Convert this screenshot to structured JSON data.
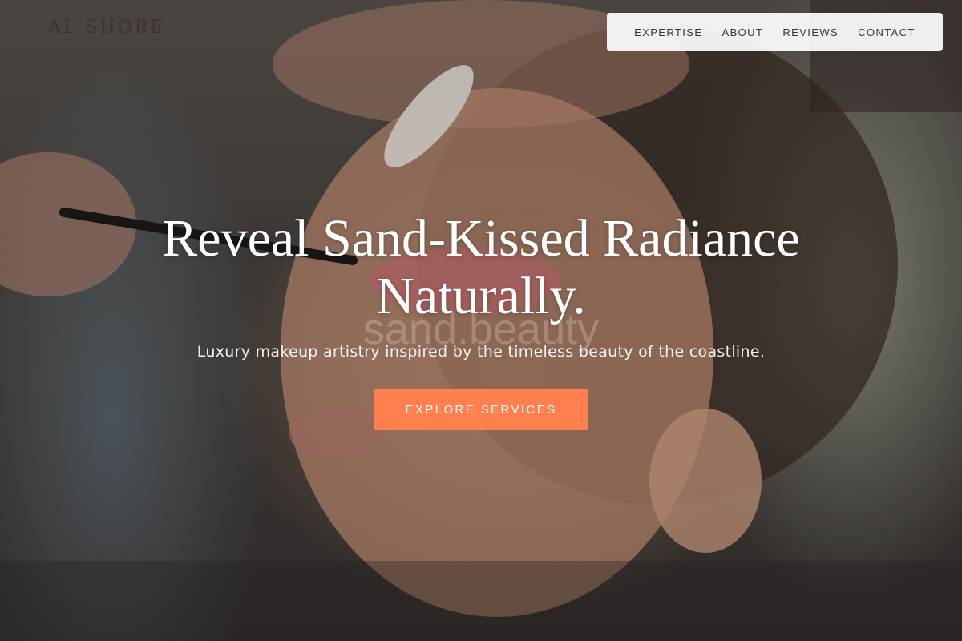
{
  "header": {
    "logo_text": "AL SHORE"
  },
  "nav": {
    "items": [
      {
        "label": "EXPERTISE"
      },
      {
        "label": "ABOUT"
      },
      {
        "label": "REVIEWS"
      },
      {
        "label": "CONTACT"
      }
    ]
  },
  "hero": {
    "headline": "Reveal Sand-Kissed Radiance Naturally.",
    "watermark": "sand.beauty",
    "subtitle": "Luxury makeup artistry inspired by the timeless beauty of the coastline.",
    "cta_label": "EXPLORE SERVICES"
  },
  "colors": {
    "accent": "#ff7f4f",
    "nav_background": "#ffffff",
    "headline_text": "#ffffff"
  }
}
